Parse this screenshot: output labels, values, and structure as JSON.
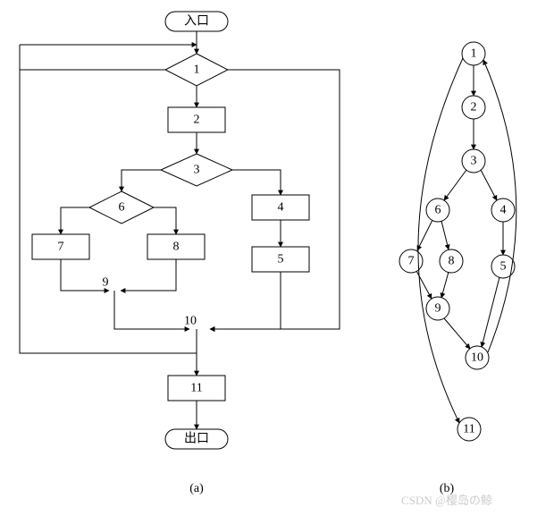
{
  "flowchart": {
    "entry": "入口",
    "exit": "出口",
    "nodes": {
      "n1": "1",
      "n2": "2",
      "n3": "3",
      "n4": "4",
      "n5": "5",
      "n6": "6",
      "n7": "7",
      "n8": "8",
      "n9": "9",
      "n10": "10",
      "n11": "11"
    },
    "caption": "(a)"
  },
  "cfg": {
    "nodes": {
      "n1": "1",
      "n2": "2",
      "n3": "3",
      "n4": "4",
      "n5": "5",
      "n6": "6",
      "n7": "7",
      "n8": "8",
      "n9": "9",
      "n10": "10",
      "n11": "11"
    },
    "caption": "(b)"
  },
  "watermark": "CSDN @樱岛の鲸"
}
